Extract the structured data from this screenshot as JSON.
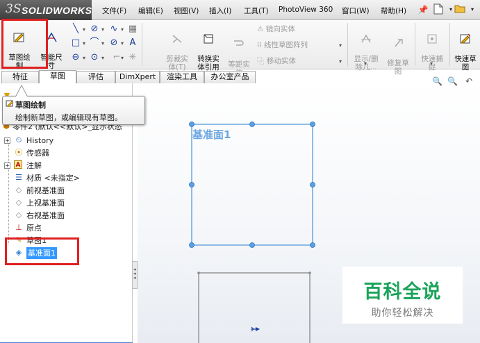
{
  "app": {
    "logo_prefix": "3S",
    "logo_text": "SOLIDWORKS"
  },
  "menu": {
    "items": [
      "文件(F)",
      "编辑(E)",
      "视图(V)",
      "插入(I)",
      "工具(T)",
      "PhotoView 360",
      "窗口(W)",
      "帮助(H)"
    ]
  },
  "toolbar": {
    "sketch_label": "草图绘\n制",
    "smart_dim_label": "智能尺\n寸",
    "trim_label": "剪裁实\n体(T)",
    "convert_label": "转换实\n体引用",
    "offset_label": "等距实\n体",
    "mirror_label": "镜向实体",
    "linear_pattern_label": "线性草图阵列",
    "move_label": "移动实体",
    "show_delete_label": "显示/删\n除几...",
    "repair_label": "修复草\n图",
    "quick_snap_label": "快速捕\n捉",
    "rapid_sketch_label": "快速草\n图"
  },
  "tabs": [
    "特征",
    "草图",
    "评估",
    "DimXpert",
    "渲染工具",
    "办公室产品"
  ],
  "active_tab": 1,
  "tooltip": {
    "title": "草图绘制",
    "description": "绘制新草图，或编辑现有草图。"
  },
  "tree": {
    "part": "零件2  (默认<<默认>_显示状态",
    "items": [
      {
        "label": "History",
        "icon": "history-icon"
      },
      {
        "label": "传感器",
        "icon": "sensor-icon"
      },
      {
        "label": "注解",
        "icon": "annotation-icon"
      },
      {
        "label": "材质 <未指定>",
        "icon": "material-icon"
      },
      {
        "label": "前视基准面",
        "icon": "plane-icon"
      },
      {
        "label": "上视基准面",
        "icon": "plane-icon"
      },
      {
        "label": "右视基准面",
        "icon": "plane-icon"
      },
      {
        "label": "原点",
        "icon": "origin-icon"
      },
      {
        "label": "草图1",
        "icon": "sketch-icon"
      },
      {
        "label": "基准面1",
        "icon": "plane-icon"
      }
    ],
    "selected_index": 9
  },
  "viewport": {
    "plane_label": "基准面1"
  },
  "watermark": {
    "main": "百科全说",
    "sub": "助你轻松解决"
  },
  "colors": {
    "highlight": "#e02020",
    "selection": "#3399ff",
    "plane_edge": "#6aa6e0",
    "watermark": "#1aa35a"
  }
}
